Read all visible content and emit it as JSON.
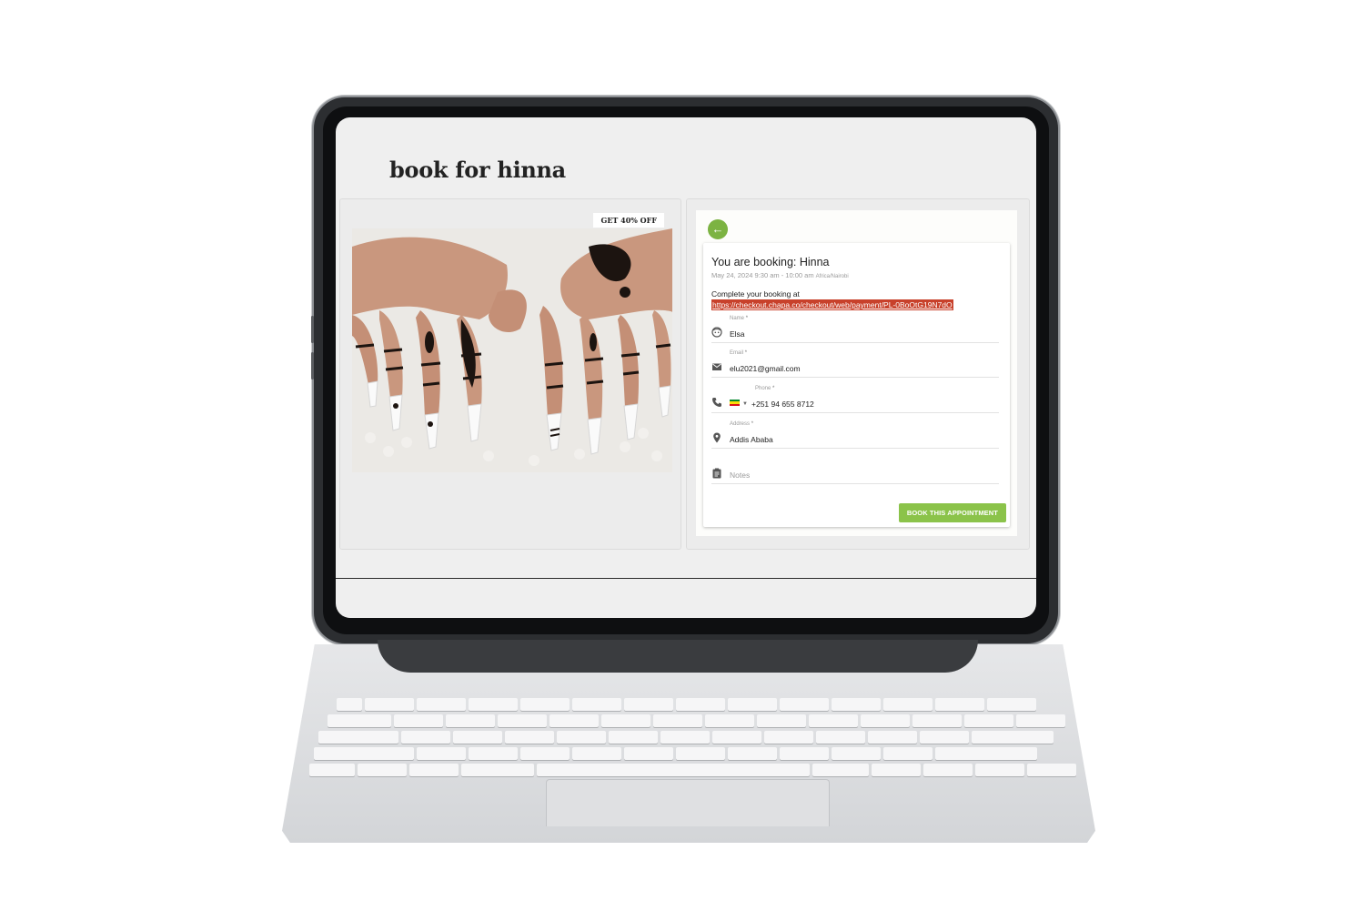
{
  "page": {
    "title": "book for hinna"
  },
  "promo": {
    "tag": "GET 40% OFF"
  },
  "booking": {
    "heading": "You are booking: Hinna",
    "datetime": "May 24, 2024 9:30 am - 10:00 am",
    "timezone": "Africa/Nairobi",
    "complete_text": "Complete your booking at",
    "checkout_url": "https://checkout.chapa.co/checkout/web/payment/PL-0BoOtG19N7dO"
  },
  "form": {
    "name": {
      "label": "Name",
      "required": "*",
      "value": "Elsa"
    },
    "email": {
      "label": "Email",
      "required": "*",
      "value": "elu2021@gmail.com"
    },
    "phone": {
      "label": "Phone",
      "required": "*",
      "value": "+251 94 655 8712",
      "flag": "ethiopia-flag"
    },
    "address": {
      "label": "Address",
      "required": "*",
      "value": "Addis Ababa"
    },
    "notes": {
      "placeholder": "Notes"
    }
  },
  "actions": {
    "book_label": "BOOK THIS APPOINTMENT",
    "back_icon": "arrow-left-icon"
  },
  "colors": {
    "accent_green": "#8bc34a",
    "link_highlight": "#c8412b"
  }
}
